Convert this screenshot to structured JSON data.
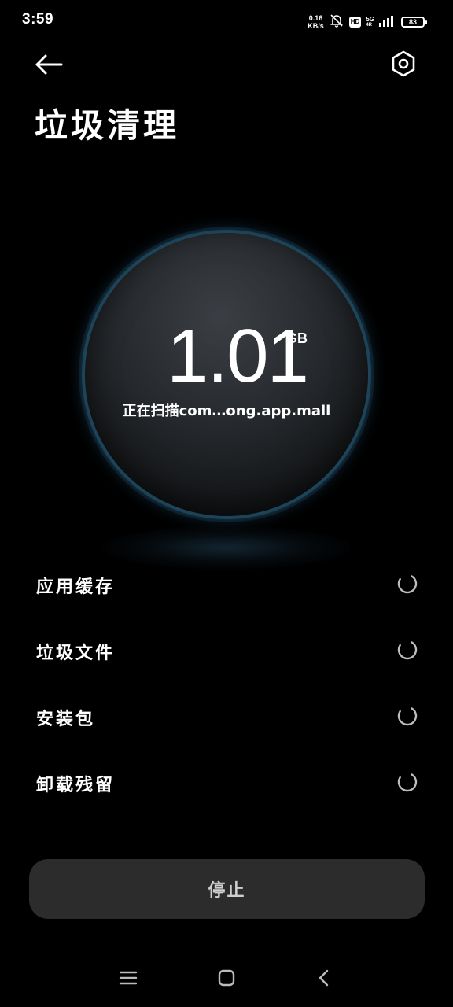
{
  "status_bar": {
    "time": "3:59",
    "net_speed_value": "0.16",
    "net_speed_unit": "KB/s",
    "hd_label": "HD",
    "network_gen": "5G",
    "network_sub": "4R",
    "battery": "83"
  },
  "header": {
    "title": "垃圾清理",
    "back_icon": "back-arrow-icon",
    "settings_icon": "settings-hexagon-icon"
  },
  "scan": {
    "size_value": "1.01",
    "size_unit": "GB",
    "status_text": "正在扫描com…ong.app.mall"
  },
  "categories": [
    {
      "label": "应用缓存",
      "status": "scanning"
    },
    {
      "label": "垃圾文件",
      "status": "scanning"
    },
    {
      "label": "安装包",
      "status": "scanning"
    },
    {
      "label": "卸载残留",
      "status": "scanning"
    }
  ],
  "actions": {
    "stop_label": "停止"
  },
  "nav_bar": {
    "menu_icon": "menu-icon",
    "home_icon": "home-icon",
    "back_icon": "nav-back-icon"
  },
  "colors": {
    "background": "#000000",
    "button_bg": "#2c2c2c",
    "orb_ring": "#28556e"
  }
}
